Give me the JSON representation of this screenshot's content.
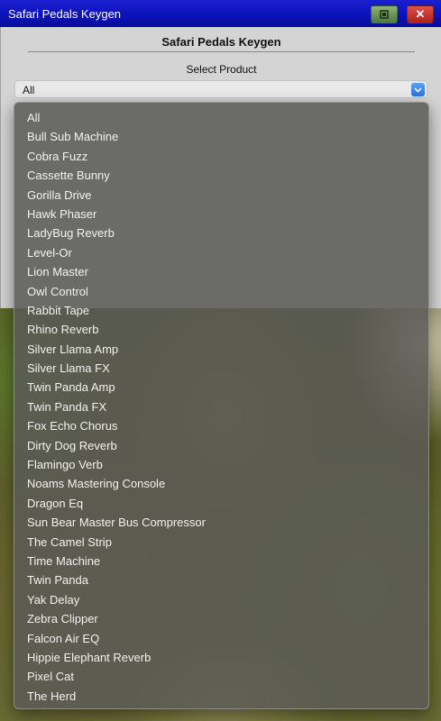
{
  "window": {
    "title": "Safari Pedals Keygen",
    "min_icon": "minimize-icon",
    "close_icon": "close-icon",
    "close_glyph": "✕"
  },
  "app": {
    "heading": "Safari Pedals Keygen",
    "select_label": "Select Product",
    "selected_value": "All"
  },
  "dropdown": {
    "options": [
      "All",
      "Bull Sub Machine",
      "Cobra Fuzz",
      "Cassette Bunny",
      "Gorilla Drive",
      "Hawk Phaser",
      "LadyBug Reverb",
      "Level-Or",
      "Lion Master",
      "Owl Control",
      "Rabbit Tape",
      "Rhino Reverb",
      "Silver Llama Amp",
      "Silver Llama FX",
      "Twin Panda Amp",
      "Twin Panda FX",
      "Fox Echo Chorus",
      "Dirty Dog Reverb",
      "Flamingo Verb",
      "Noams Mastering Console",
      "Dragon Eq",
      "Sun Bear Master Bus Compressor",
      "The Camel Strip",
      "Time Machine",
      "Twin Panda",
      "Yak Delay",
      "Zebra Clipper",
      "Falcon Air EQ",
      "Hippie Elephant Reverb",
      "Pixel Cat",
      "The Herd"
    ]
  },
  "colors": {
    "titlebar": "#0b12b8",
    "window_bg": "#d4d4d4",
    "accent_blue": "#2a74e0",
    "close_red": "#c0302a",
    "minimize_green": "#4e7a3e"
  }
}
